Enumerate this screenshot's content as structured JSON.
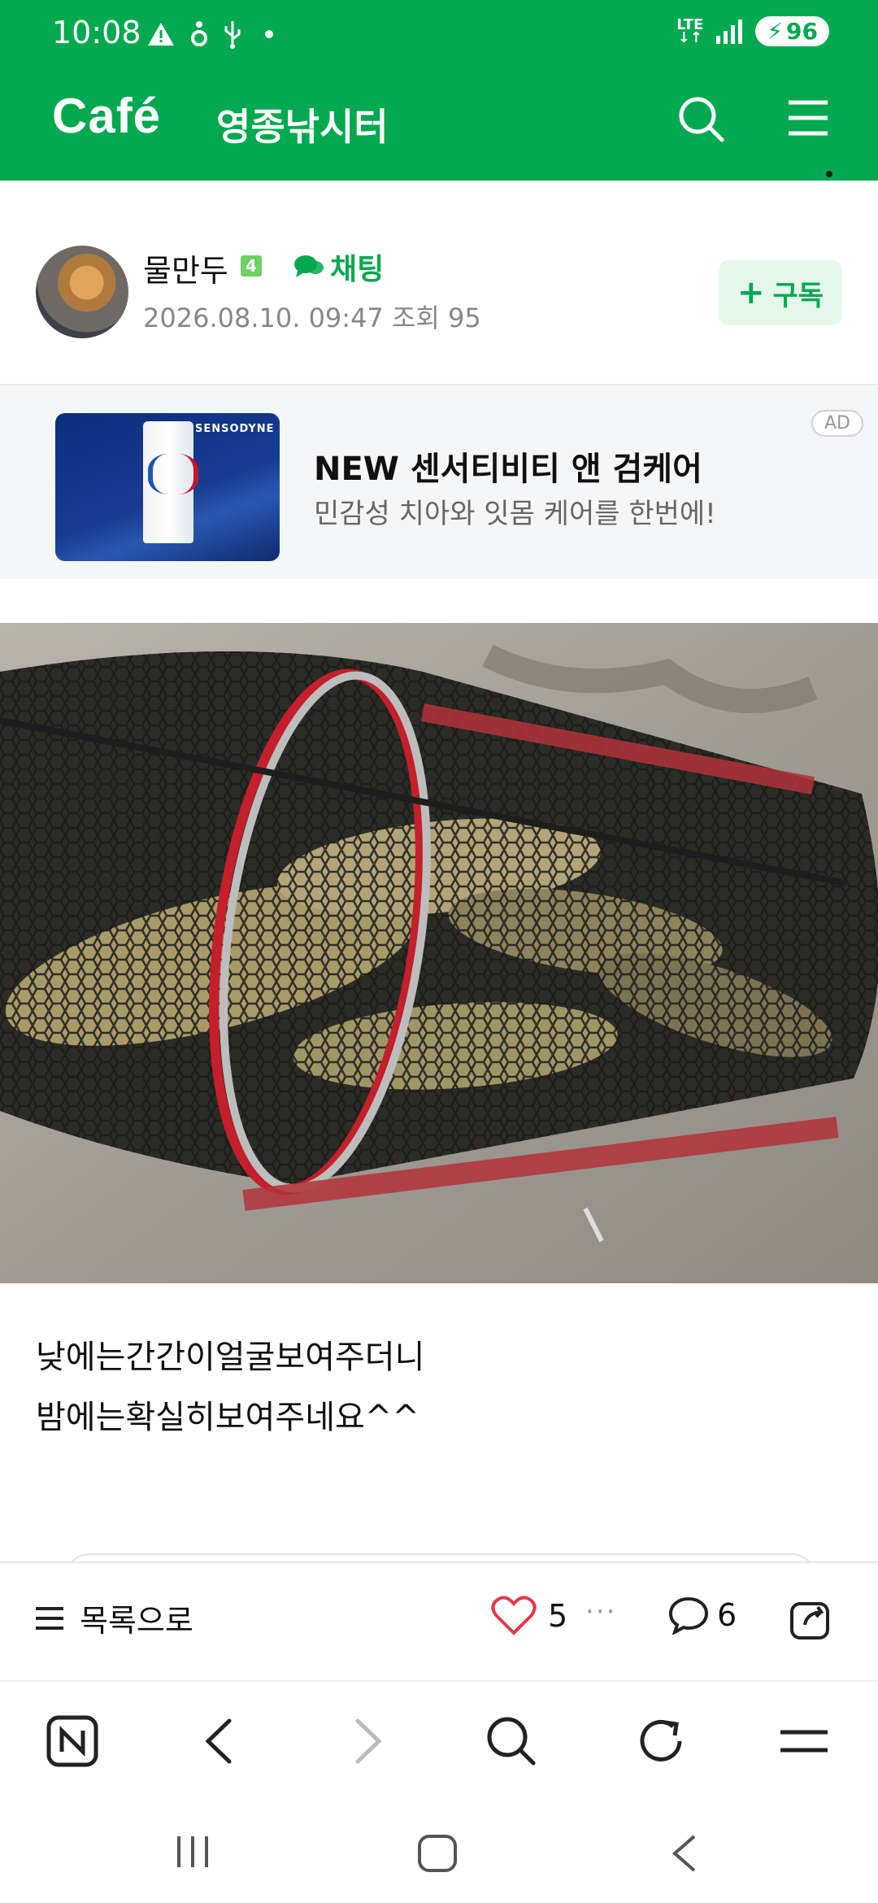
{
  "status_bar": {
    "time": "10:08",
    "network": "LTE",
    "battery": "96"
  },
  "header": {
    "logo": "Café",
    "cafe_name": "영종낚시터"
  },
  "post": {
    "author": {
      "name": "물만두",
      "level": "4",
      "chat_label": "채팅",
      "meta": "2026.08.10. 09:47  조회 95"
    },
    "subscribe_label": "구독",
    "photo_alt": "",
    "body_lines": [
      "낮에는간간이얼굴보여주더니",
      "밤에는확실히보여주네요^^"
    ]
  },
  "ad": {
    "badge": "AD",
    "title": "NEW 센서티비티 앤 검케어",
    "description": "민감성 치아와 잇몸 케어를 한번에!",
    "brand": "SENSODYNE"
  },
  "action_bar": {
    "list_label": "목록으로",
    "like_count": "5",
    "comment_count": "6"
  },
  "colors": {
    "brand_green": "#03a94f",
    "like_red": "#e5394a"
  }
}
